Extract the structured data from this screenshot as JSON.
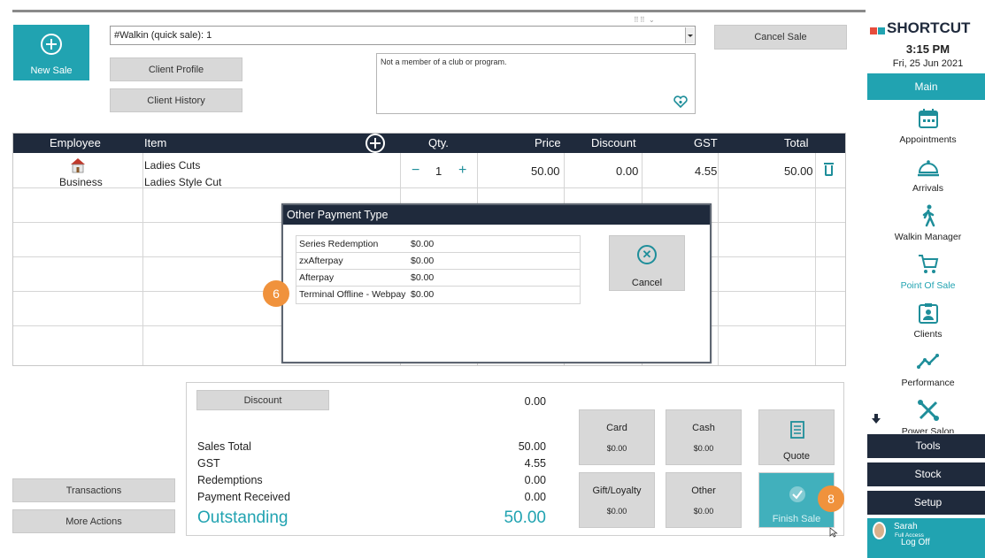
{
  "sale": {
    "new_sale_label": "New Sale",
    "client_select_value": "#Walkin (quick sale): 1",
    "client_profile_label": "Client Profile",
    "client_history_label": "Client History",
    "cancel_sale_label": "Cancel Sale",
    "membership_note": "Not a member of a club or program."
  },
  "table": {
    "headers": {
      "employee": "Employee",
      "item": "Item",
      "qty": "Qty.",
      "price": "Price",
      "discount": "Discount",
      "gst": "GST",
      "total": "Total"
    },
    "rows": [
      {
        "employee": "Business",
        "item": "Ladies Cuts",
        "item_sub": "Ladies Style Cut",
        "qty": "1",
        "price": "50.00",
        "discount": "0.00",
        "gst": "4.55",
        "total": "50.00"
      }
    ],
    "qty_minus": "−",
    "qty_plus": "+"
  },
  "modal": {
    "title": "Other Payment Type",
    "options": [
      {
        "name": "Series Redemption",
        "amount": "$0.00"
      },
      {
        "name": "zxAfterpay",
        "amount": "$0.00"
      },
      {
        "name": "Afterpay",
        "amount": "$0.00"
      },
      {
        "name": "Terminal Offline - Webpay",
        "amount": "$0.00"
      }
    ],
    "cancel_label": "Cancel"
  },
  "badges": {
    "six": "6",
    "eight": "8"
  },
  "totals": {
    "discount_label": "Discount",
    "discount_value": "0.00",
    "sales_total_label": "Sales Total",
    "sales_total_value": "50.00",
    "gst_label": "GST",
    "gst_value": "4.55",
    "redemptions_label": "Redemptions",
    "redemptions_value": "0.00",
    "payment_received_label": "Payment Received",
    "payment_received_value": "0.00",
    "outstanding_label": "Outstanding",
    "outstanding_value": "50.00"
  },
  "payments": {
    "card_label": "Card",
    "card_amount": "$0.00",
    "cash_label": "Cash",
    "cash_amount": "$0.00",
    "quote_label": "Quote",
    "gift_label": "Gift/Loyalty",
    "gift_amount": "$0.00",
    "other_label": "Other",
    "other_amount": "$0.00",
    "finish_label": "Finish Sale"
  },
  "left_actions": {
    "transactions": "Transactions",
    "more_actions": "More Actions"
  },
  "sidebar": {
    "brand": "SHORTCUT",
    "time": "3:15 PM",
    "date": "Fri, 25 Jun 2021",
    "main_tab": "Main",
    "items": [
      {
        "label": "Appointments",
        "icon": "calendar-icon"
      },
      {
        "label": "Arrivals",
        "icon": "bell-icon"
      },
      {
        "label": "Walkin Manager",
        "icon": "walking-person-icon"
      },
      {
        "label": "Point Of Sale",
        "icon": "cart-icon"
      },
      {
        "label": "Clients",
        "icon": "contact-card-icon"
      },
      {
        "label": "Performance",
        "icon": "trend-line-icon"
      },
      {
        "label": "Power Salon",
        "icon": "tools-icon"
      }
    ],
    "tools": "Tools",
    "stock": "Stock",
    "setup": "Setup",
    "user_name": "Sarah",
    "user_access": "Full Access",
    "logoff": "Log Off"
  },
  "colors": {
    "accent": "#21a3b1",
    "header": "#1f2a3c",
    "badge": "#f0923c"
  }
}
